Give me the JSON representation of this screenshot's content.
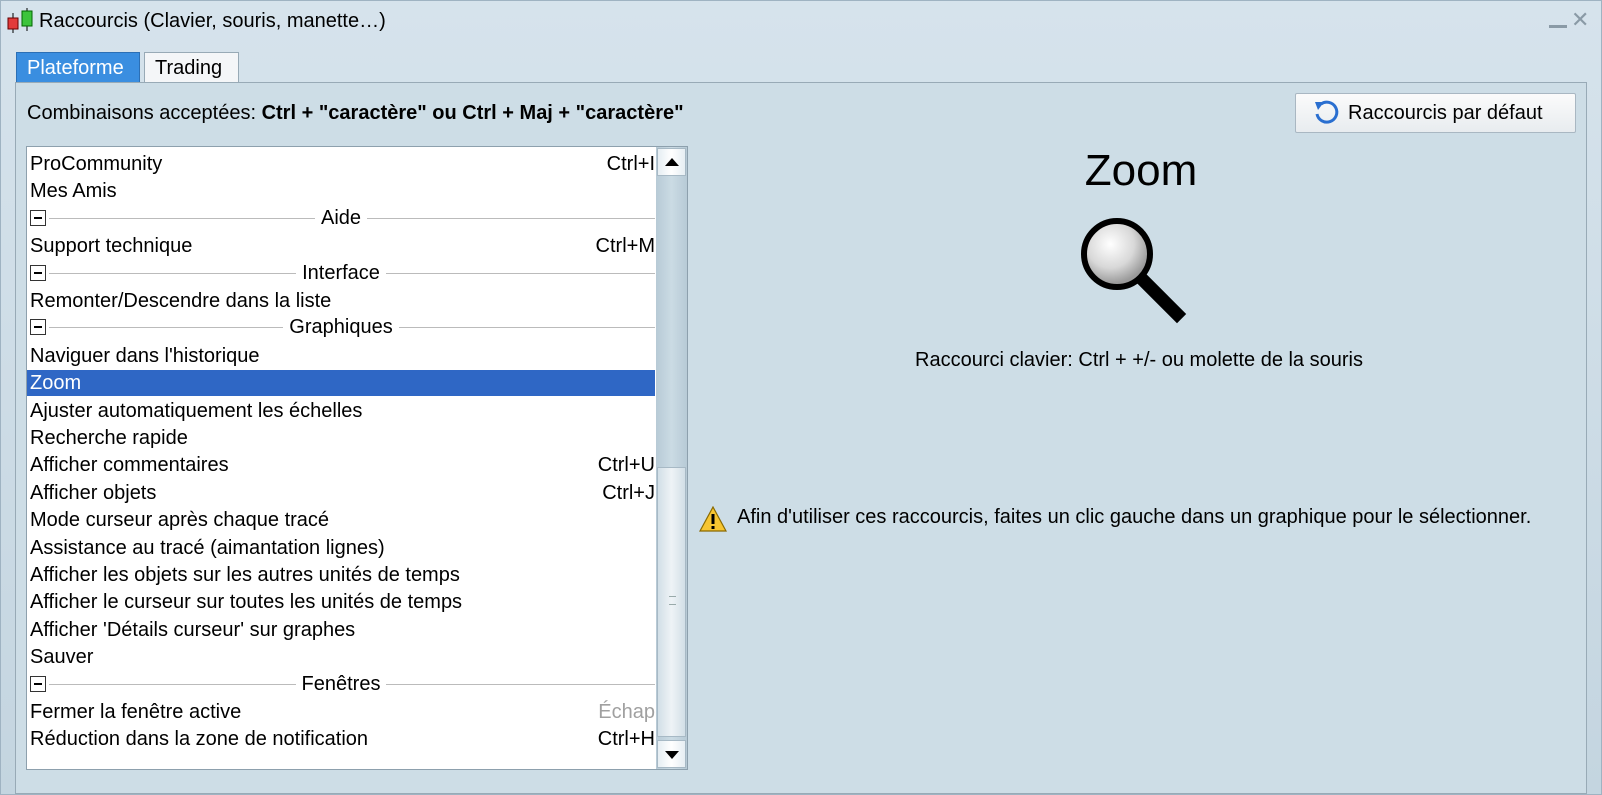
{
  "window": {
    "title": "Raccourcis (Clavier, souris, manette…)",
    "minimize_glyph": "",
    "close_glyph": "✕"
  },
  "tabs": [
    {
      "label": "Plateforme",
      "active": true
    },
    {
      "label": "Trading",
      "active": false
    }
  ],
  "hint": {
    "prefix": "Combinaisons acceptées: ",
    "combos": "Ctrl + \"caractère\" ou Ctrl + Maj + \"caractère\""
  },
  "reset_button": {
    "label": "Raccourcis par défaut",
    "icon": "refresh-icon"
  },
  "list": {
    "rows": [
      {
        "type": "item",
        "label": "ProCommunity",
        "shortcut": "Ctrl+I"
      },
      {
        "type": "item",
        "label": "Mes Amis",
        "shortcut": ""
      },
      {
        "type": "group",
        "label": "Aide"
      },
      {
        "type": "item",
        "label": "Support technique",
        "shortcut": "Ctrl+M"
      },
      {
        "type": "group",
        "label": "Interface"
      },
      {
        "type": "item",
        "label": "Remonter/Descendre dans la liste",
        "shortcut": ""
      },
      {
        "type": "group",
        "label": "Graphiques"
      },
      {
        "type": "item",
        "label": "Naviguer dans l'historique",
        "shortcut": ""
      },
      {
        "type": "item",
        "label": "Zoom",
        "shortcut": "",
        "selected": true
      },
      {
        "type": "item",
        "label": "Ajuster automatiquement les échelles",
        "shortcut": ""
      },
      {
        "type": "item",
        "label": "Recherche rapide",
        "shortcut": ""
      },
      {
        "type": "item",
        "label": "Afficher commentaires",
        "shortcut": "Ctrl+U"
      },
      {
        "type": "item",
        "label": "Afficher objets",
        "shortcut": "Ctrl+J"
      },
      {
        "type": "item",
        "label": "Mode curseur après chaque tracé",
        "shortcut": ""
      },
      {
        "type": "item",
        "label": "Assistance au tracé (aimantation lignes)",
        "shortcut": ""
      },
      {
        "type": "item",
        "label": "Afficher les objets sur les autres unités de temps",
        "shortcut": ""
      },
      {
        "type": "item",
        "label": "Afficher le curseur sur toutes les unités de temps",
        "shortcut": ""
      },
      {
        "type": "item",
        "label": "Afficher 'Détails curseur' sur graphes",
        "shortcut": ""
      },
      {
        "type": "item",
        "label": "Sauver",
        "shortcut": ""
      },
      {
        "type": "group",
        "label": "Fenêtres"
      },
      {
        "type": "item",
        "label": "Fermer la fenêtre active",
        "shortcut": "Échap",
        "shortcut_disabled": true
      },
      {
        "type": "item",
        "label": "Réduction dans la zone de notification",
        "shortcut": "Ctrl+H"
      }
    ]
  },
  "detail": {
    "title": "Zoom",
    "icon": "magnifier-icon",
    "shortcut_info": "Raccourci clavier: Ctrl + +/- ou molette de la souris",
    "warning_icon": "warning-icon",
    "warning_text": "Afin d'utiliser ces raccourcis, faites un clic gauche dans un graphique pour le sélectionner."
  },
  "colors": {
    "selection": "#2f67c5",
    "active_tab": "#3a8ee0",
    "panel_bg": "#cddde6"
  }
}
